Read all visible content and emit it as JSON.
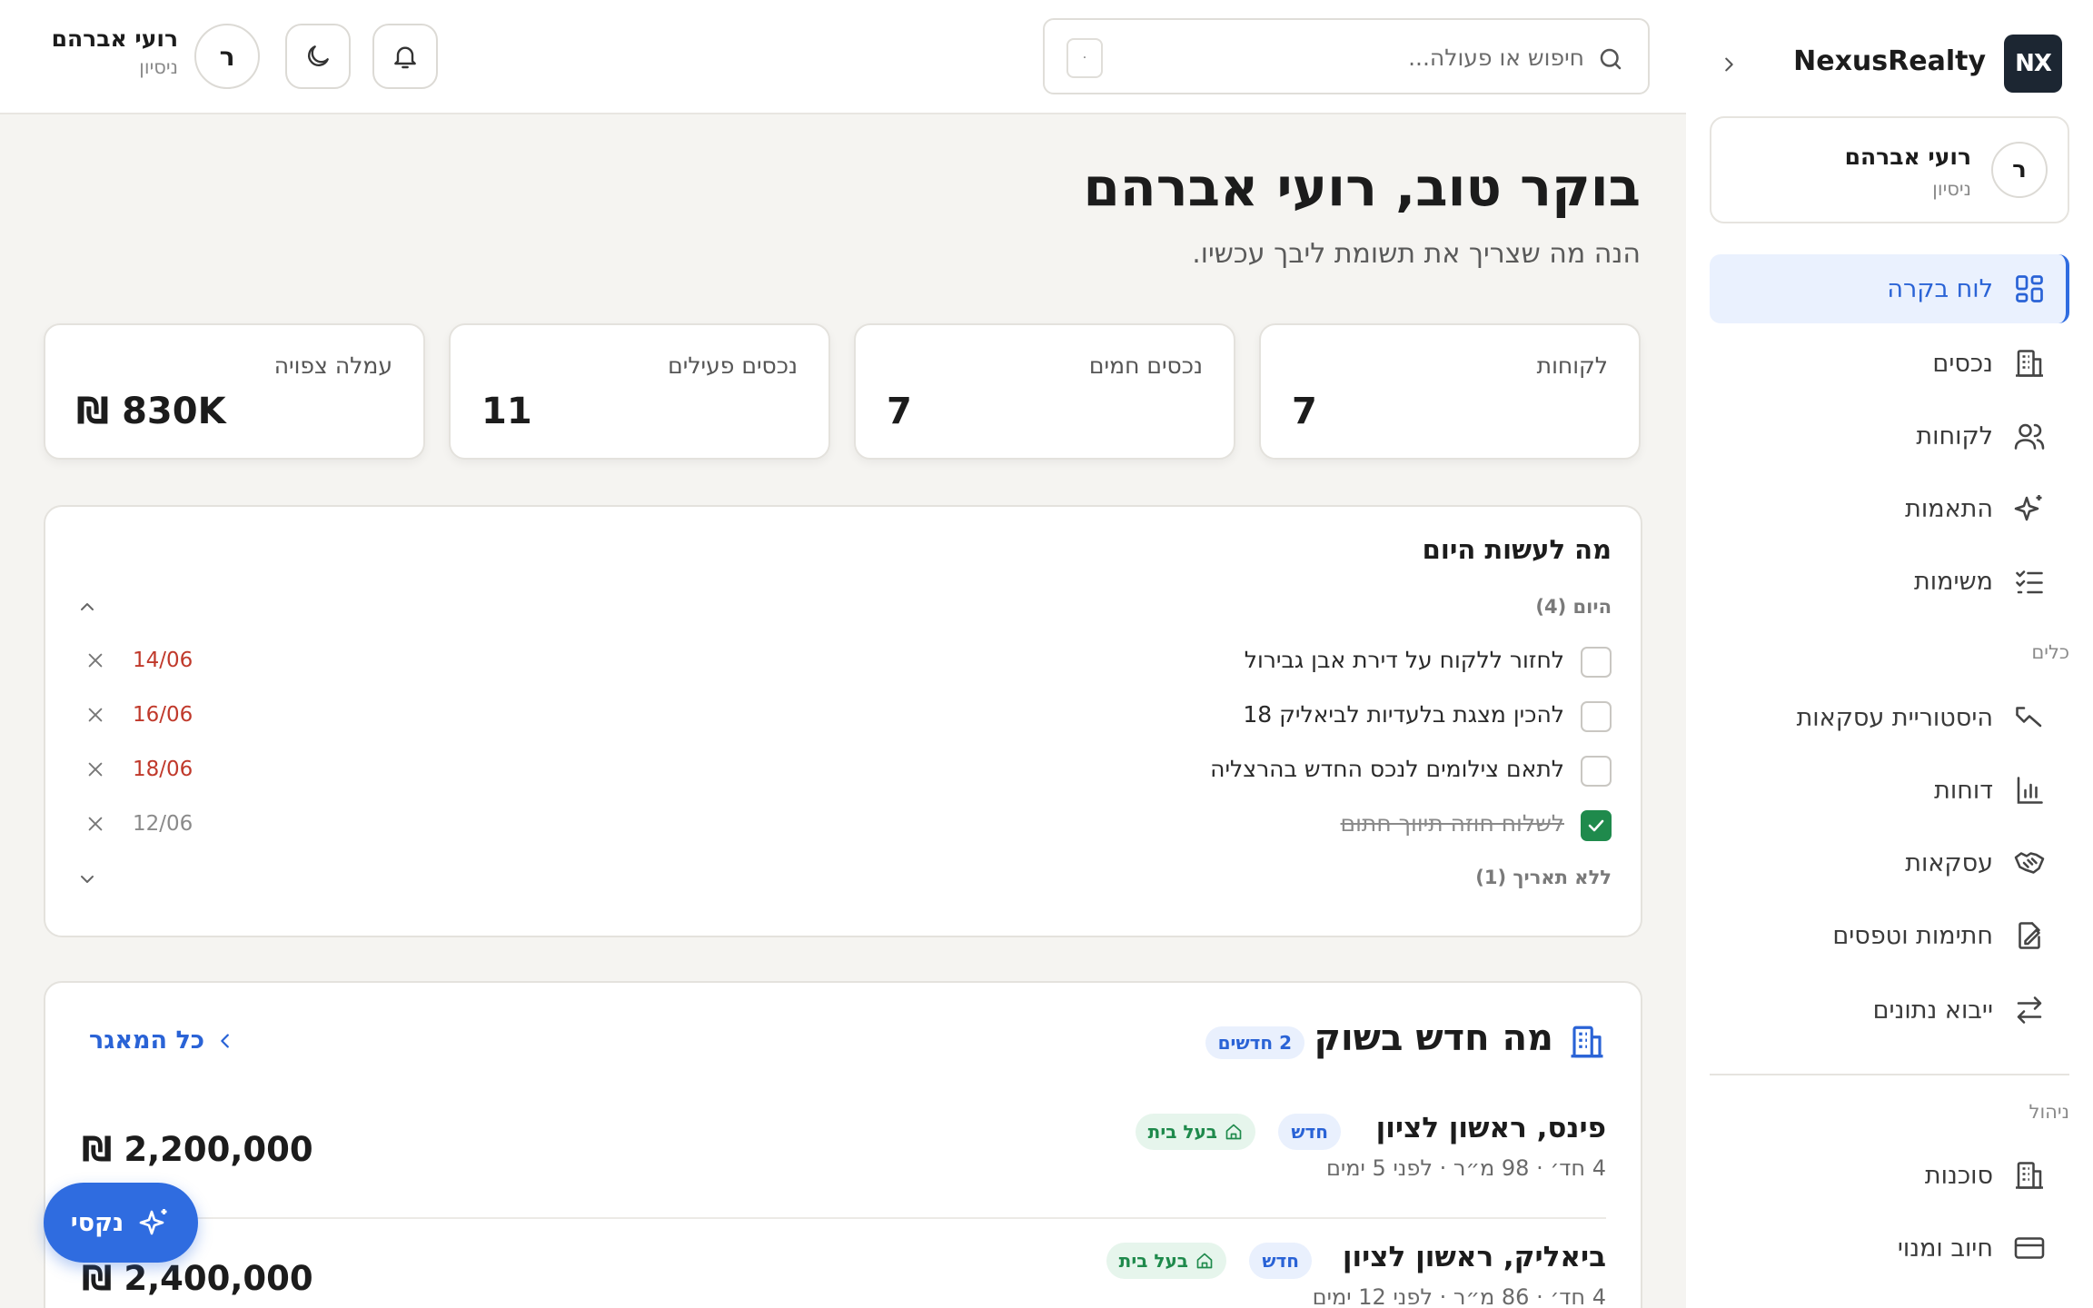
{
  "brand": {
    "logo_text": "NX",
    "name": "NexusRealty"
  },
  "user": {
    "initial": "ר",
    "name": "רועי אברהם",
    "role": "ניסיון"
  },
  "sidebar": {
    "items": [
      {
        "label": "לוח בקרה",
        "icon": "dashboard-icon",
        "active": true
      },
      {
        "label": "נכסים",
        "icon": "building-icon"
      },
      {
        "label": "לקוחות",
        "icon": "users-icon"
      },
      {
        "label": "התאמות",
        "icon": "sparkles-icon"
      },
      {
        "label": "משימות",
        "icon": "checklist-icon"
      }
    ],
    "tools_section": "כלים",
    "tools": [
      {
        "label": "היסטוריית עסקאות",
        "icon": "trend-icon"
      },
      {
        "label": "דוחות",
        "icon": "bar-chart-icon"
      },
      {
        "label": "עסקאות",
        "icon": "handshake-icon"
      },
      {
        "label": "חתימות וטפסים",
        "icon": "signature-icon"
      },
      {
        "label": "ייבוא נתונים",
        "icon": "arrows-icon"
      }
    ],
    "admin_section": "ניהול",
    "admin": [
      {
        "label": "סוכנות",
        "icon": "agency-icon"
      },
      {
        "label": "חיוב ומנוי",
        "icon": "credit-card-icon"
      }
    ]
  },
  "search": {
    "placeholder": "חיפוש או פעולה...",
    "shortcut": "·"
  },
  "main": {
    "greeting": "בוקר טוב, רועי אברהם",
    "subtitle": "הנה מה שצריך את תשומת ליבך עכשיו."
  },
  "stats": [
    {
      "label": "לקוחות",
      "value": "7"
    },
    {
      "label": "נכסים חמים",
      "value": "7"
    },
    {
      "label": "נכסים פעילים",
      "value": "11"
    },
    {
      "label": "עמלה צפויה",
      "value": "₪ 830K"
    }
  ],
  "todo": {
    "title": "מה לעשות היום",
    "today_label": "היום (4)",
    "no_date_label": "ללא תאריך (1)",
    "tasks": [
      {
        "text": "לחזור ללקוח על דירת אבן גבירול",
        "date": "14/06",
        "done": false
      },
      {
        "text": "להכין מצגת בלעדיות לביאליק 18",
        "date": "16/06",
        "done": false
      },
      {
        "text": "לתאם צילומים לנכס החדש בהרצליה",
        "date": "18/06",
        "done": false
      },
      {
        "text": "לשלוח חוזה תיווך חתום",
        "date": "12/06",
        "done": true
      }
    ]
  },
  "market": {
    "title": "מה חדש בשוק",
    "badge": "2 חדשים",
    "all_link": "כל המאגר",
    "listings": [
      {
        "address": "פינס, ראשון לציון",
        "tag_new": "חדש",
        "tag_owner": "בעל בית",
        "meta": "4 חד׳ · 98 מ״ר · לפני 5 ימים",
        "price": "₪ 2,200,000"
      },
      {
        "address": "ביאליק, ראשון לציון",
        "tag_new": "חדש",
        "tag_owner": "בעל בית",
        "meta": "4 חד׳ · 86 מ״ר · לפני 12 ימים",
        "price": "₪ 2,400,000"
      }
    ]
  },
  "assistant": {
    "label": "נקסי"
  }
}
